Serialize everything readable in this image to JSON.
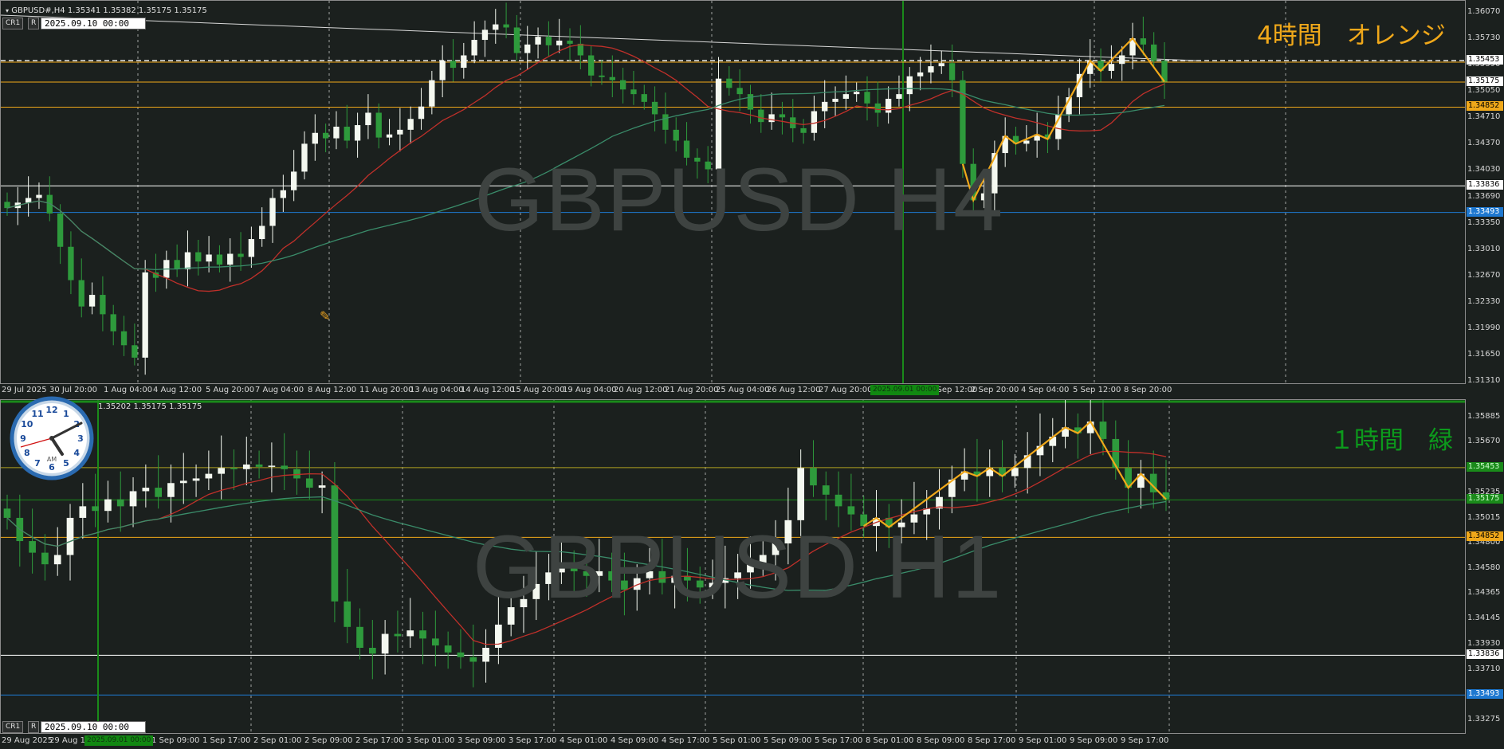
{
  "colors": {
    "bg": "#1b201e",
    "grid": "#d0d0d0",
    "bull": "#f4f8f0",
    "bear": "#2e9a3c",
    "ma_fast": "#c0302a",
    "ma_slow": "#3a8c6a",
    "orange": "#f0a81a",
    "green_text": "#0c9a1c",
    "white": "#e8e8e8",
    "blue": "#1e78d0",
    "green_vline": "#1a8a1a"
  },
  "top": {
    "header": "GBPUSD#,H4  1.35341 1.35382 1.35175 1.35175",
    "btn_a": "CR1",
    "btn_b": "R",
    "date_box": "2025.09.10 00:00",
    "watermark": "GBPUSD H4",
    "tf_label": "4時間　オレンジ",
    "y_ticks": [
      "1.36070",
      "1.35730",
      "1.35390",
      "1.35050",
      "1.34710",
      "1.34370",
      "1.34030",
      "1.33690",
      "1.33350",
      "1.33010",
      "1.32670",
      "1.32330",
      "1.31990",
      "1.31650",
      "1.31310"
    ],
    "level_labels": [
      {
        "text": "1.35453",
        "style": "white"
      },
      {
        "text": "1.35175",
        "style": "white"
      },
      {
        "text": "1.34852",
        "style": "orange"
      },
      {
        "text": "1.33836",
        "style": "white"
      },
      {
        "text": "1.33493",
        "style": "blue"
      }
    ],
    "x_ticks": [
      "29 Jul 2025",
      "30 Jul 20:00",
      "1 Aug 04:00",
      "4 Aug 12:00",
      "5 Aug 20:00",
      "7 Aug 04:00",
      "8 Aug 12:00",
      "11 Aug 20:00",
      "13 Aug 04:00",
      "14 Aug 12:00",
      "15 Aug 20:00",
      "19 Aug 04:00",
      "20 Aug 12:00",
      "21 Aug 20:00",
      "25 Aug 04:00",
      "26 Aug 12:00",
      "27 Aug 20:00",
      "2 Sep 12:00",
      "2 Sep 20:00",
      "4 Sep 04:00",
      "5 Sep 12:00",
      "8 Sep 20:00"
    ],
    "x_highlight": "2025.09.01 00:00",
    "price_path": [
      1.3355,
      1.3362,
      1.3368,
      1.3372,
      1.3348,
      1.3305,
      1.3262,
      1.3228,
      1.3243,
      1.3218,
      1.3196,
      1.3178,
      1.3162,
      1.3272,
      1.3265,
      1.3288,
      1.3276,
      1.3298,
      1.3286,
      1.3295,
      1.3282,
      1.3296,
      1.3292,
      1.3315,
      1.3332,
      1.3368,
      1.3378,
      1.3402,
      1.3438,
      1.3452,
      1.3445,
      1.346,
      1.3442,
      1.3462,
      1.3478,
      1.3446,
      1.345,
      1.3456,
      1.347,
      1.3486,
      1.352,
      1.3545,
      1.3536,
      1.3552,
      1.3572,
      1.3585,
      1.3592,
      1.3588,
      1.3555,
      1.3566,
      1.3576,
      1.3565,
      1.3571,
      1.3567,
      1.3552,
      1.3526,
      1.3524,
      1.352,
      1.3508,
      1.3502,
      1.3492,
      1.3476,
      1.3456,
      1.3442,
      1.342,
      1.3415,
      1.3405,
      1.3522,
      1.351,
      1.3502,
      1.3482,
      1.3466,
      1.3476,
      1.3472,
      1.3458,
      1.3452,
      1.348,
      1.3492,
      1.3496,
      1.3502,
      1.3505,
      1.349,
      1.3478,
      1.3496,
      1.3502,
      1.3525,
      1.353,
      1.3538,
      1.3542,
      1.352,
      1.3412,
      1.3365,
      1.3374,
      1.3426,
      1.3448,
      1.3438,
      1.3442,
      1.345,
      1.3444,
      1.3476,
      1.3498,
      1.3528,
      1.3545,
      1.3532,
      1.3541,
      1.3552,
      1.3574,
      1.3566,
      1.3545,
      1.3518
    ],
    "h_levels": [
      1.35453,
      1.35175,
      1.34852,
      1.33836,
      1.33493
    ]
  },
  "bottom": {
    "header": "1.35202 1.35175 1.35175",
    "btn_a": "CR1",
    "btn_b": "R",
    "date_box": "2025.09.10 00:00",
    "watermark": "GBPUSD H1",
    "tf_label": "１時間　緑",
    "clock_am": "AM",
    "y_ticks": [
      "1.35885",
      "1.35670",
      "1.35455",
      "1.35235",
      "1.35015",
      "1.34800",
      "1.34580",
      "1.34365",
      "1.34145",
      "1.33930",
      "1.33710",
      "1.33275"
    ],
    "level_labels": [
      {
        "text": "1.35453",
        "style": "green"
      },
      {
        "text": "1.35175",
        "style": "green"
      },
      {
        "text": "1.34852",
        "style": "orange"
      },
      {
        "text": "1.33836",
        "style": "white"
      },
      {
        "text": "1.33493",
        "style": "blue"
      }
    ],
    "x_ticks": [
      "29 Aug 2025",
      "29 Aug 17:00",
      "1 Sep 01:00",
      "1 Sep 09:00",
      "1 Sep 17:00",
      "2 Sep 01:00",
      "2 Sep 09:00",
      "2 Sep 17:00",
      "3 Sep 01:00",
      "3 Sep 09:00",
      "3 Sep 17:00",
      "4 Sep 01:00",
      "4 Sep 09:00",
      "4 Sep 17:00",
      "5 Sep 01:00",
      "5 Sep 09:00",
      "5 Sep 17:00",
      "8 Sep 01:00",
      "8 Sep 09:00",
      "8 Sep 17:00",
      "9 Sep 01:00",
      "9 Sep 09:00",
      "9 Sep 17:00"
    ],
    "x_highlight": "2025.09.01 00:00",
    "price_path": [
      1.3502,
      1.3482,
      1.3472,
      1.3462,
      1.347,
      1.3502,
      1.3512,
      1.3508,
      1.3518,
      1.3512,
      1.3525,
      1.3528,
      1.352,
      1.3532,
      1.3534,
      1.3536,
      1.354,
      1.3545,
      1.3544,
      1.3548,
      1.3546,
      1.3547,
      1.3544,
      1.3536,
      1.3528,
      1.353,
      1.343,
      1.3408,
      1.339,
      1.3385,
      1.3402,
      1.34,
      1.3405,
      1.3398,
      1.3392,
      1.3386,
      1.3382,
      1.3378,
      1.339,
      1.341,
      1.3425,
      1.3432,
      1.3445,
      1.3455,
      1.3462,
      1.3456,
      1.3452,
      1.3456,
      1.3448,
      1.344,
      1.345,
      1.3456,
      1.3446,
      1.3452,
      1.3448,
      1.3442,
      1.3446,
      1.345,
      1.3455,
      1.3462,
      1.347,
      1.348,
      1.35,
      1.3545,
      1.353,
      1.3522,
      1.3512,
      1.3505,
      1.3495,
      1.3502,
      1.3494,
      1.3498,
      1.3505,
      1.351,
      1.352,
      1.3535,
      1.3542,
      1.3538,
      1.3545,
      1.3538,
      1.3545,
      1.3556,
      1.3564,
      1.3572,
      1.358,
      1.3575,
      1.3585,
      1.357,
      1.3545,
      1.3528,
      1.354,
      1.3524,
      1.3518
    ],
    "h_levels": [
      1.35453,
      1.35175,
      1.34852,
      1.33836,
      1.33493
    ]
  }
}
